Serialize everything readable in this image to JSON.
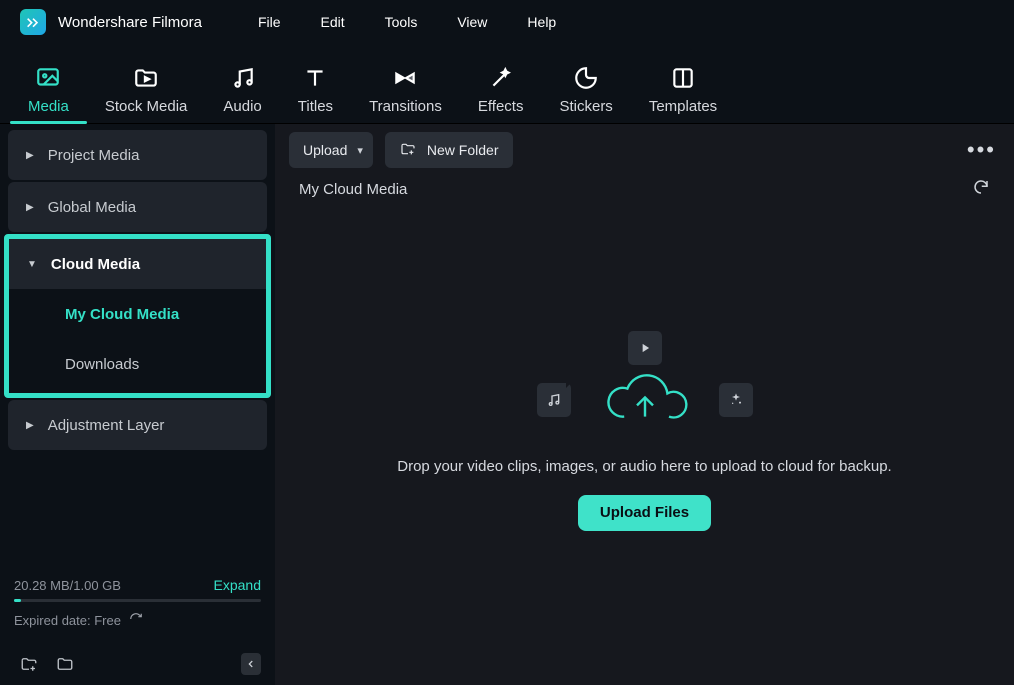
{
  "app": {
    "title": "Wondershare Filmora"
  },
  "menubar": [
    "File",
    "Edit",
    "Tools",
    "View",
    "Help"
  ],
  "tabs": [
    {
      "label": "Media",
      "active": true
    },
    {
      "label": "Stock Media"
    },
    {
      "label": "Audio"
    },
    {
      "label": "Titles"
    },
    {
      "label": "Transitions"
    },
    {
      "label": "Effects"
    },
    {
      "label": "Stickers"
    },
    {
      "label": "Templates"
    }
  ],
  "sidebar": {
    "project_media": "Project Media",
    "global_media": "Global Media",
    "cloud_media": "Cloud Media",
    "my_cloud_media": "My Cloud Media",
    "downloads": "Downloads",
    "adjustment_layer": "Adjustment Layer"
  },
  "storage": {
    "usage": "20.28 MB/1.00 GB",
    "expand": "Expand",
    "expired": "Expired date: Free"
  },
  "toolbar": {
    "upload": "Upload",
    "new_folder": "New Folder"
  },
  "panel": {
    "title": "My Cloud Media",
    "drop_text": "Drop your video clips, images, or audio here to upload to cloud for backup.",
    "upload_files": "Upload Files"
  }
}
